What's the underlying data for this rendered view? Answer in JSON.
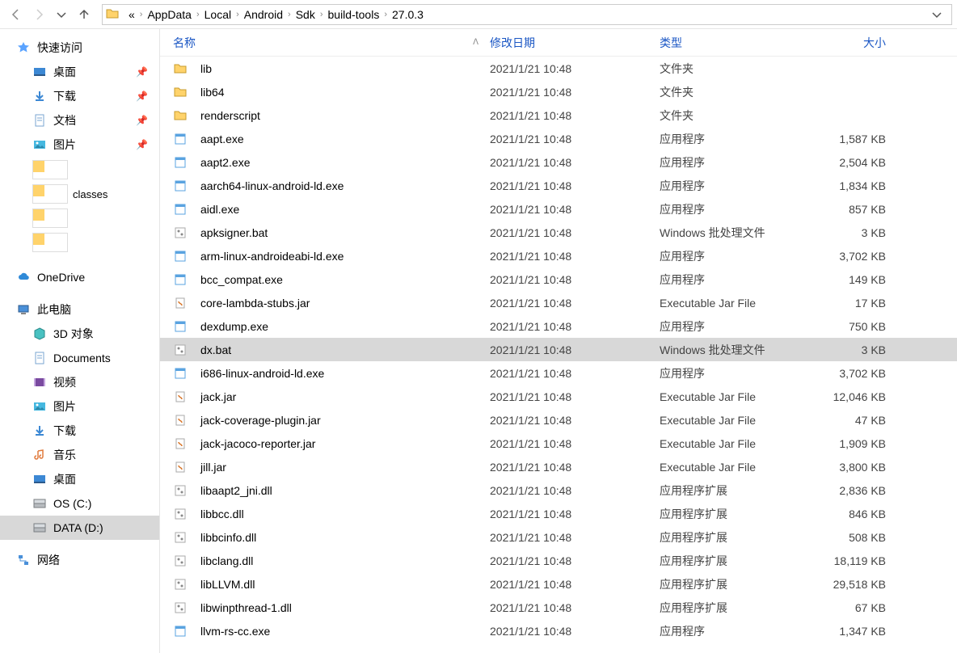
{
  "breadcrumbs": [
    "«",
    "AppData",
    "Local",
    "Android",
    "Sdk",
    "build-tools",
    "27.0.3"
  ],
  "headers": {
    "name": "名称",
    "date": "修改日期",
    "type": "类型",
    "size": "大小"
  },
  "sidebar": {
    "quick": {
      "label": "快速访问",
      "items": [
        {
          "label": "桌面",
          "icon": "desktop",
          "pin": true
        },
        {
          "label": "下载",
          "icon": "download",
          "pin": true
        },
        {
          "label": "文档",
          "icon": "doc",
          "pin": true
        },
        {
          "label": "图片",
          "icon": "pic",
          "pin": true
        }
      ]
    },
    "thumbFolders": [
      {
        "label": ""
      },
      {
        "label": "classes"
      },
      {
        "label": ""
      },
      {
        "label": ""
      }
    ],
    "onedrive": {
      "label": "OneDrive"
    },
    "thispc": {
      "label": "此电脑",
      "items": [
        {
          "label": "3D 对象",
          "icon": "cube"
        },
        {
          "label": "Documents",
          "icon": "doc"
        },
        {
          "label": "视频",
          "icon": "video"
        },
        {
          "label": "图片",
          "icon": "pic"
        },
        {
          "label": "下载",
          "icon": "download"
        },
        {
          "label": "音乐",
          "icon": "music"
        },
        {
          "label": "桌面",
          "icon": "desktop"
        },
        {
          "label": "OS (C:)",
          "icon": "drive"
        },
        {
          "label": "DATA (D:)",
          "icon": "drive",
          "selected": true
        }
      ]
    },
    "network": {
      "label": "网络"
    }
  },
  "files": [
    {
      "icon": "folder",
      "name": "lib",
      "date": "2021/1/21 10:48",
      "type": "文件夹",
      "size": ""
    },
    {
      "icon": "folder",
      "name": "lib64",
      "date": "2021/1/21 10:48",
      "type": "文件夹",
      "size": ""
    },
    {
      "icon": "folder",
      "name": "renderscript",
      "date": "2021/1/21 10:48",
      "type": "文件夹",
      "size": ""
    },
    {
      "icon": "exe",
      "name": "aapt.exe",
      "date": "2021/1/21 10:48",
      "type": "应用程序",
      "size": "1,587 KB"
    },
    {
      "icon": "exe",
      "name": "aapt2.exe",
      "date": "2021/1/21 10:48",
      "type": "应用程序",
      "size": "2,504 KB"
    },
    {
      "icon": "exe",
      "name": "aarch64-linux-android-ld.exe",
      "date": "2021/1/21 10:48",
      "type": "应用程序",
      "size": "1,834 KB"
    },
    {
      "icon": "exe",
      "name": "aidl.exe",
      "date": "2021/1/21 10:48",
      "type": "应用程序",
      "size": "857 KB"
    },
    {
      "icon": "bat",
      "name": "apksigner.bat",
      "date": "2021/1/21 10:48",
      "type": "Windows 批处理文件",
      "size": "3 KB"
    },
    {
      "icon": "exe",
      "name": "arm-linux-androideabi-ld.exe",
      "date": "2021/1/21 10:48",
      "type": "应用程序",
      "size": "3,702 KB"
    },
    {
      "icon": "exe",
      "name": "bcc_compat.exe",
      "date": "2021/1/21 10:48",
      "type": "应用程序",
      "size": "149 KB"
    },
    {
      "icon": "jar",
      "name": "core-lambda-stubs.jar",
      "date": "2021/1/21 10:48",
      "type": "Executable Jar File",
      "size": "17 KB"
    },
    {
      "icon": "exe",
      "name": "dexdump.exe",
      "date": "2021/1/21 10:48",
      "type": "应用程序",
      "size": "750 KB"
    },
    {
      "icon": "bat",
      "name": "dx.bat",
      "date": "2021/1/21 10:48",
      "type": "Windows 批处理文件",
      "size": "3 KB",
      "selected": true
    },
    {
      "icon": "exe",
      "name": "i686-linux-android-ld.exe",
      "date": "2021/1/21 10:48",
      "type": "应用程序",
      "size": "3,702 KB"
    },
    {
      "icon": "jar",
      "name": "jack.jar",
      "date": "2021/1/21 10:48",
      "type": "Executable Jar File",
      "size": "12,046 KB"
    },
    {
      "icon": "jar",
      "name": "jack-coverage-plugin.jar",
      "date": "2021/1/21 10:48",
      "type": "Executable Jar File",
      "size": "47 KB"
    },
    {
      "icon": "jar",
      "name": "jack-jacoco-reporter.jar",
      "date": "2021/1/21 10:48",
      "type": "Executable Jar File",
      "size": "1,909 KB"
    },
    {
      "icon": "jar",
      "name": "jill.jar",
      "date": "2021/1/21 10:48",
      "type": "Executable Jar File",
      "size": "3,800 KB"
    },
    {
      "icon": "dll",
      "name": "libaapt2_jni.dll",
      "date": "2021/1/21 10:48",
      "type": "应用程序扩展",
      "size": "2,836 KB"
    },
    {
      "icon": "dll",
      "name": "libbcc.dll",
      "date": "2021/1/21 10:48",
      "type": "应用程序扩展",
      "size": "846 KB"
    },
    {
      "icon": "dll",
      "name": "libbcinfo.dll",
      "date": "2021/1/21 10:48",
      "type": "应用程序扩展",
      "size": "508 KB"
    },
    {
      "icon": "dll",
      "name": "libclang.dll",
      "date": "2021/1/21 10:48",
      "type": "应用程序扩展",
      "size": "18,119 KB"
    },
    {
      "icon": "dll",
      "name": "libLLVM.dll",
      "date": "2021/1/21 10:48",
      "type": "应用程序扩展",
      "size": "29,518 KB"
    },
    {
      "icon": "dll",
      "name": "libwinpthread-1.dll",
      "date": "2021/1/21 10:48",
      "type": "应用程序扩展",
      "size": "67 KB"
    },
    {
      "icon": "exe",
      "name": "llvm-rs-cc.exe",
      "date": "2021/1/21 10:48",
      "type": "应用程序",
      "size": "1,347 KB"
    }
  ]
}
